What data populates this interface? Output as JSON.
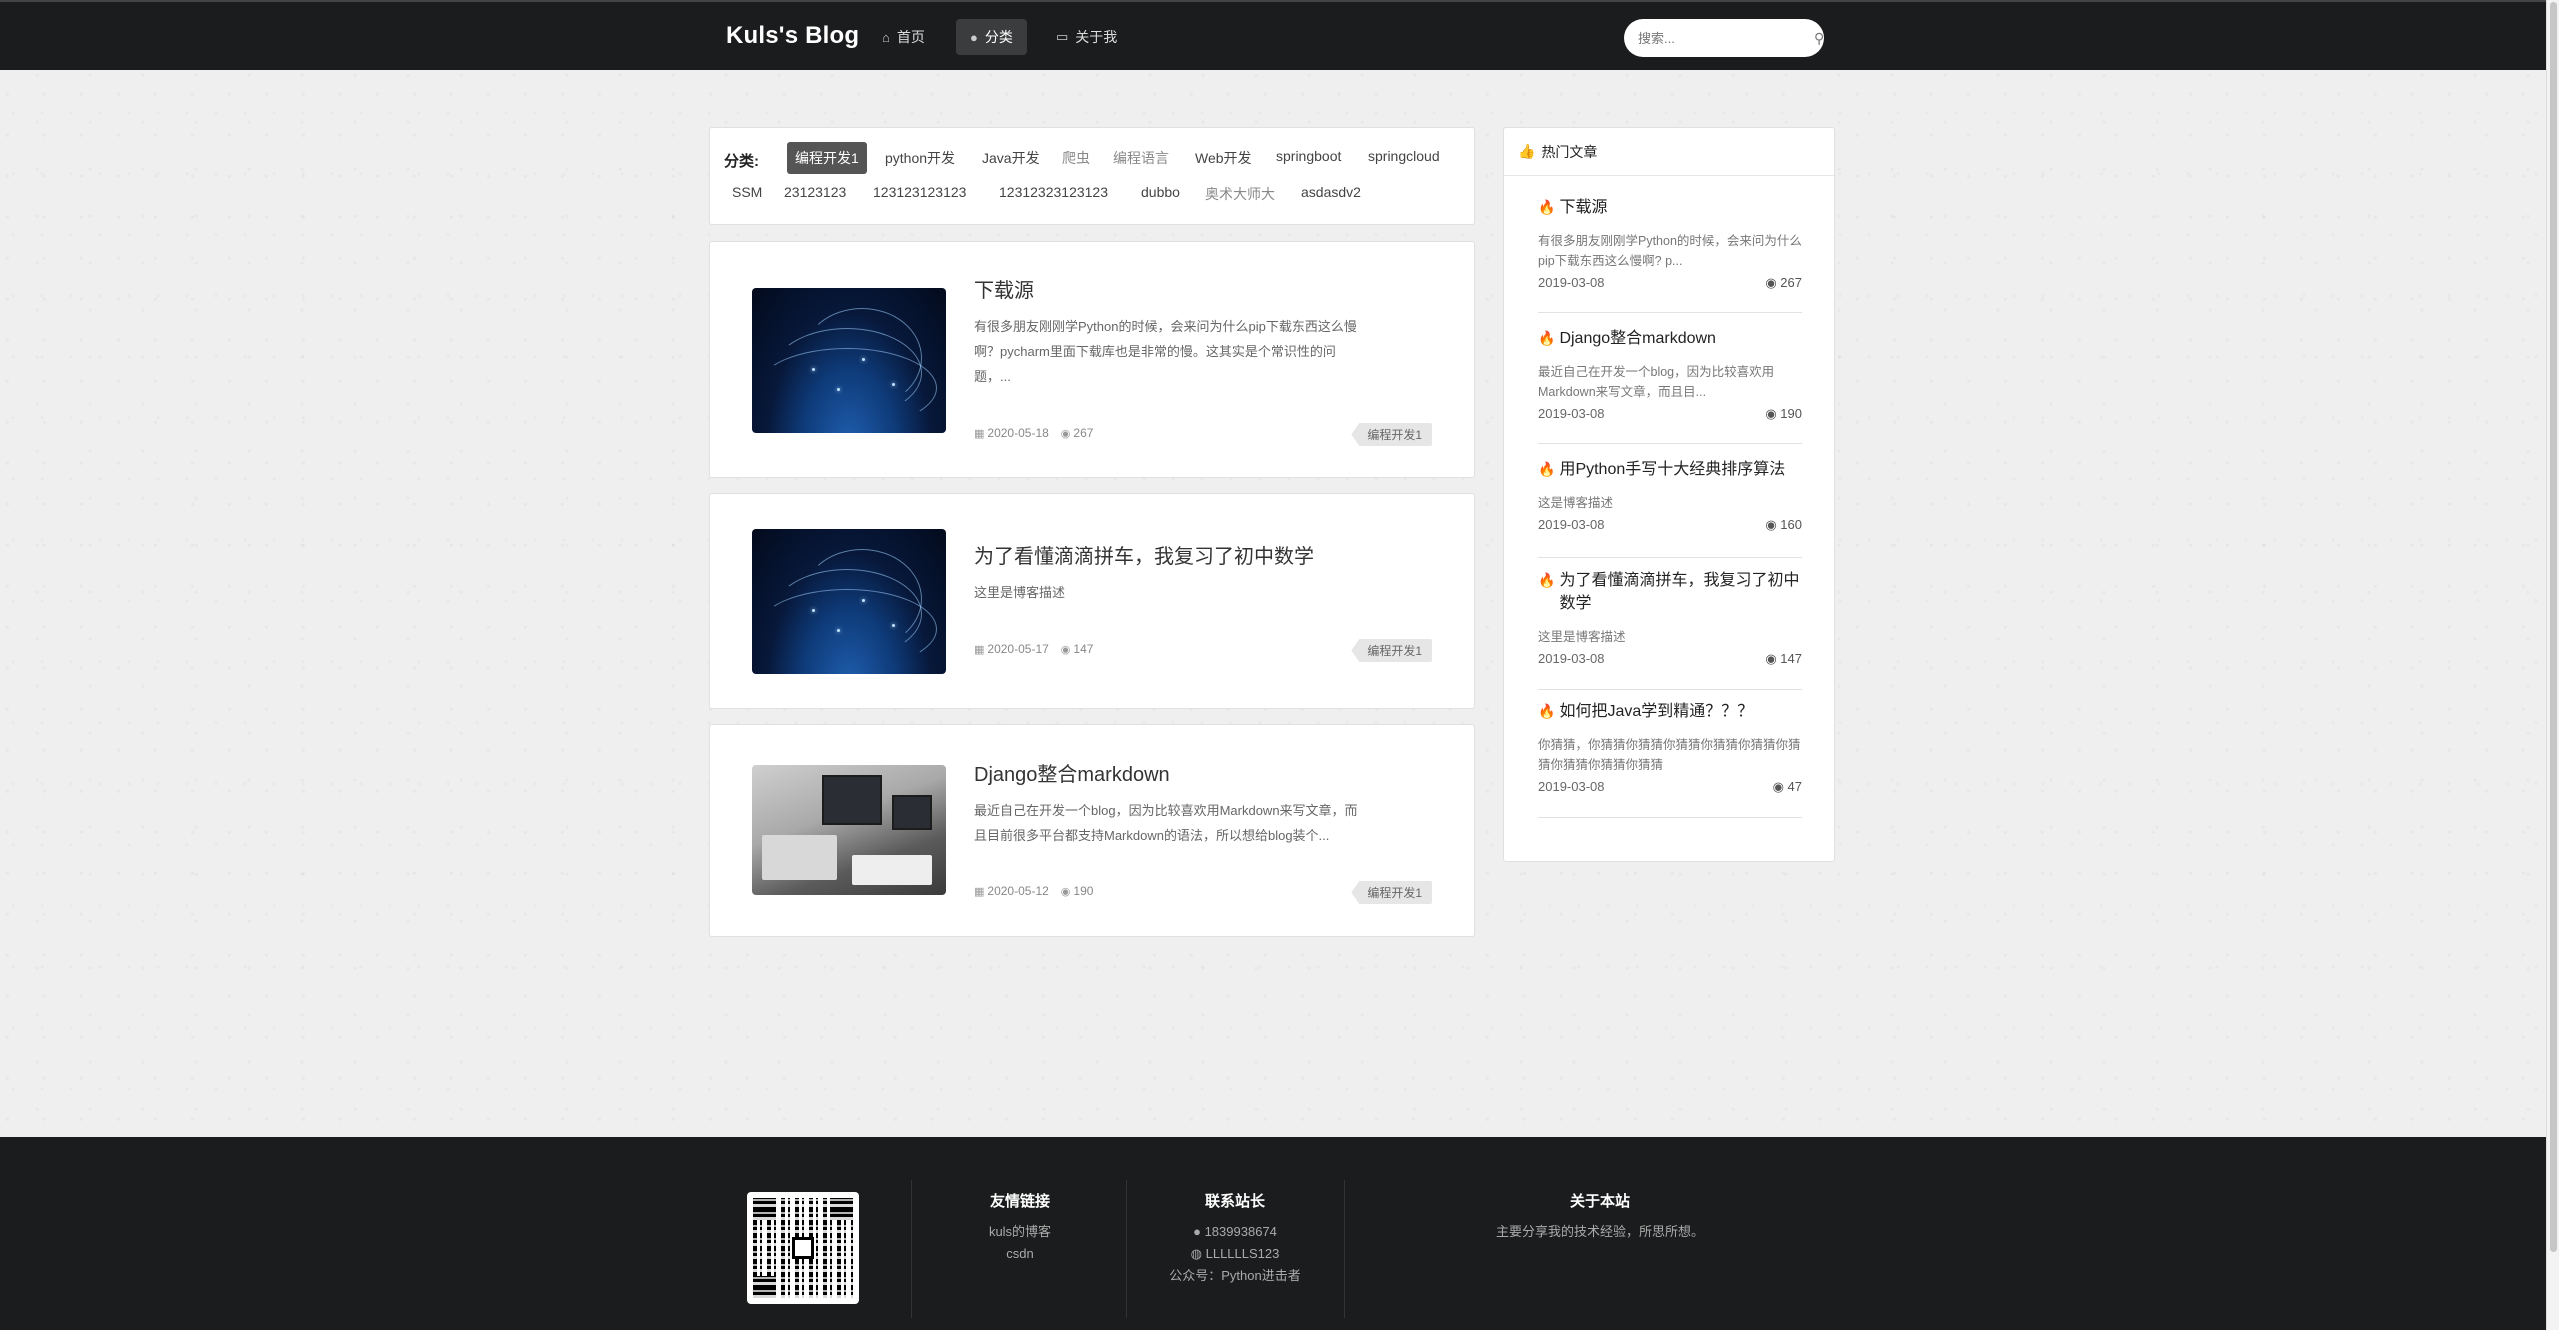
{
  "header": {
    "logo": "Kuls's Blog",
    "nav": [
      {
        "label": "首页",
        "icon": "home-icon"
      },
      {
        "label": "分类",
        "icon": "lightbulb-icon"
      },
      {
        "label": "关于我",
        "icon": "id-card-icon"
      }
    ],
    "search_placeholder": "搜索..."
  },
  "categories": {
    "title": "分类:",
    "tags": [
      "编程开发1",
      "python开发",
      "Java开发",
      "爬虫",
      "编程语言",
      "Web开发",
      "springboot",
      "springcloud",
      "SSM",
      "23123123",
      "123123123123",
      "12312323123123",
      "dubbo",
      "奥术大师大",
      "asdasdv2"
    ]
  },
  "articles": [
    {
      "title": "下载源",
      "desc_lines": [
        "有很多朋友刚刚学Python的时候，会来问为什么pip下载东西这么慢",
        "啊？pycharm里面下载库也是非常的慢。这其实是个常识性的问",
        "题，..."
      ],
      "date": "2020-05-18",
      "views": "267",
      "tag": "编程开发1"
    },
    {
      "title": "为了看懂滴滴拼车，我复习了初中数学",
      "desc_lines": [
        "这里是博客描述"
      ],
      "date": "2020-05-17",
      "views": "147",
      "tag": "编程开发1"
    },
    {
      "title": "Django整合markdown",
      "desc_lines": [
        "最近自己在开发一个blog，因为比较喜欢用Markdown来写文章，而",
        "且目前很多平台都支持Markdown的语法，所以想给blog装个..."
      ],
      "date": "2020-05-12",
      "views": "190",
      "tag": "编程开发1"
    }
  ],
  "sidebar": {
    "title": "热门文章",
    "items": [
      {
        "title": "下载源",
        "desc": "有很多朋友刚刚学Python的时候，会来问为什么pip下载东西这么慢啊? p...",
        "date": "2019-03-08",
        "views": "267"
      },
      {
        "title": "Django整合markdown",
        "desc": "最近自己在开发一个blog，因为比较喜欢用Markdown来写文章，而且目...",
        "date": "2019-03-08",
        "views": "190"
      },
      {
        "title": "用Python手写十大经典排序算法",
        "desc": "这是博客描述",
        "date": "2019-03-08",
        "views": "160"
      },
      {
        "title": "为了看懂滴滴拼车，我复习了初中数学",
        "desc": "这里是博客描述",
        "date": "2019-03-08",
        "views": "147"
      },
      {
        "title": "如何把Java学到精通？？？",
        "desc": "你猜猜，你猜猜你猜猜你猜猜你猜猜你猜猜你猜猜你猜猜你猜猜你猜猜",
        "date": "2019-03-08",
        "views": "47"
      }
    ]
  },
  "footer": {
    "links": {
      "title": "友情链接",
      "items": [
        "kuls的博客",
        "csdn"
      ]
    },
    "contact": {
      "title": "联系站长",
      "qq": "1839938674",
      "wechat": "LLLLLLS123",
      "public": "公众号：Python进击者"
    },
    "about": {
      "title": "关于本站",
      "text": "主要分享我的技术经验，所思所想。"
    }
  }
}
